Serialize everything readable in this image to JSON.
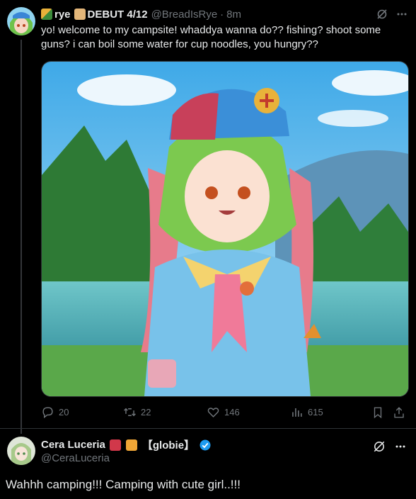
{
  "post": {
    "author_name": "rye",
    "author_suffix": "DEBUT 4/12",
    "handle": "@BreadIsRye",
    "separator": "·",
    "time": "8m",
    "text": "yo! welcome to my campsite! whaddya wanna do?? fishing? shoot some guns? i can boil some water for cup noodles, you hungry??",
    "media_icons": [
      "grok-icon",
      "more-icon"
    ],
    "stats": {
      "replies": "20",
      "reposts": "22",
      "likes": "146",
      "views": "615"
    }
  },
  "reply": {
    "author_name": "Cera Luceria",
    "author_tag": "【globie】",
    "handle": "@CeraLuceria",
    "text": "Wahhh camping!!! Camping with cute girl..!!!",
    "verified": true
  },
  "colors": {
    "background": "#000000",
    "text": "#e7e9ea",
    "muted": "#71767b",
    "divider": "#2f3336",
    "verified": "#1d9bf0"
  }
}
